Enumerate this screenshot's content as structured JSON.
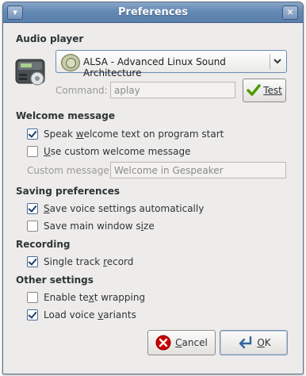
{
  "window": {
    "title": "Preferences",
    "menu_glyph": "▾",
    "close_glyph": "✕"
  },
  "audio_player": {
    "heading": "Audio player",
    "selected_option": "ALSA - Advanced Linux Sound Architecture",
    "logo_icon": "alsa-logo-icon",
    "command_label": "Command:",
    "command_value": "aplay",
    "test_button": "Test",
    "device_icon": "audio-device-icon"
  },
  "welcome_message": {
    "heading": "Welcome message",
    "speak_welcome_pre": "Speak ",
    "speak_welcome_ul": "w",
    "speak_welcome_post": "elcome text on program start",
    "speak_welcome_checked": true,
    "use_custom_ul": "U",
    "use_custom_post": "se custom welcome message",
    "use_custom_checked": false,
    "custom_label": "Custom message:",
    "custom_value": "Welcome in Gespeaker"
  },
  "saving_preferences": {
    "heading": "Saving preferences",
    "save_voice_ul": "S",
    "save_voice_post": "ave voice settings automatically",
    "save_voice_checked": true,
    "save_window_pre": "Save main window s",
    "save_window_ul": "i",
    "save_window_post": "ze",
    "save_window_checked": false
  },
  "recording": {
    "heading": "Recording",
    "single_track_pre": "Single track ",
    "single_track_ul": "r",
    "single_track_post": "ecord",
    "single_track_checked": true
  },
  "other_settings": {
    "heading": "Other settings",
    "text_wrap_pre": "Enable te",
    "text_wrap_ul": "x",
    "text_wrap_post": "t wrapping",
    "text_wrap_checked": false,
    "load_variants_pre": "Load voice ",
    "load_variants_ul": "v",
    "load_variants_post": "ariants",
    "load_variants_checked": true
  },
  "buttons": {
    "cancel_ul": "C",
    "cancel_post": "ancel",
    "ok_ul": "O",
    "ok_post": "K"
  },
  "colors": {
    "titlebar": "#6389b5",
    "window_bg": "#edeceb",
    "check_mark": "#1d3d66"
  }
}
